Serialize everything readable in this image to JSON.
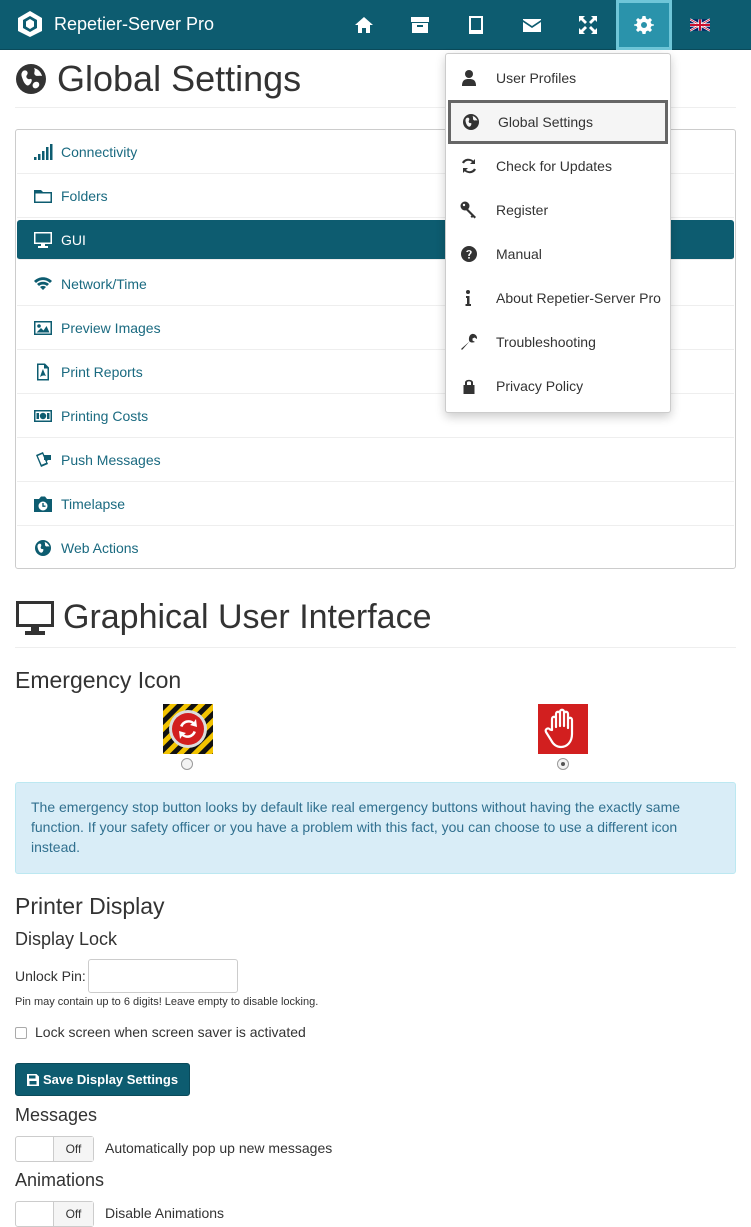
{
  "app": {
    "brand": "Repetier-Server Pro",
    "colors": {
      "primary": "#0d5c70",
      "active_nav": "#2a93ab"
    },
    "nav_icons": [
      "home-icon",
      "archive-icon",
      "tablet-icon",
      "envelope-icon",
      "fullscreen-icon",
      "gear-icon",
      "uk-flag-icon"
    ]
  },
  "page": {
    "title": "Global Settings"
  },
  "settings_menu": [
    {
      "label": "Connectivity",
      "icon": "signal-icon"
    },
    {
      "label": "Folders",
      "icon": "folder-icon"
    },
    {
      "label": "GUI",
      "icon": "monitor-icon",
      "active": true
    },
    {
      "label": "Network/Time",
      "icon": "wifi-icon"
    },
    {
      "label": "Preview Images",
      "icon": "image-icon"
    },
    {
      "label": "Print Reports",
      "icon": "pdf-icon"
    },
    {
      "label": "Printing Costs",
      "icon": "money-icon"
    },
    {
      "label": "Push Messages",
      "icon": "phone-message-icon"
    },
    {
      "label": "Timelapse",
      "icon": "camera-clock-icon"
    },
    {
      "label": "Web Actions",
      "icon": "globe-icon"
    }
  ],
  "dropdown": [
    {
      "label": "User Profiles",
      "icon": "user-icon"
    },
    {
      "label": "Global Settings",
      "icon": "globe-icon",
      "active": true
    },
    {
      "label": "Check for Updates",
      "icon": "refresh-icon"
    },
    {
      "label": "Register",
      "icon": "key-icon"
    },
    {
      "label": "Manual",
      "icon": "question-icon"
    },
    {
      "label": "About Repetier-Server Pro",
      "icon": "info-icon"
    },
    {
      "label": "Troubleshooting",
      "icon": "wrench-icon"
    },
    {
      "label": "Privacy Policy",
      "icon": "lock-icon"
    }
  ],
  "gui": {
    "title": "Graphical User Interface",
    "emergency": {
      "heading": "Emergency Icon",
      "selected": "hand",
      "info": "The emergency stop button looks by default like real emergency buttons without having the exactly same function. If your safety officer or you have a problem with this fact, you can choose to use a different icon instead."
    },
    "printer_display": {
      "heading": "Printer Display",
      "subheading": "Display Lock",
      "pin_label": "Unlock Pin:",
      "pin_value": "",
      "help": "Pin may contain up to 6 digits! Leave empty to disable locking.",
      "lock_checkbox_label": "Lock screen when screen saver is activated",
      "lock_checked": false,
      "save_label": "Save Display Settings"
    },
    "messages": {
      "heading": "Messages",
      "toggle": "Off",
      "label": "Automatically pop up new messages"
    },
    "animations": {
      "heading": "Animations",
      "toggle": "Off",
      "label": "Disable Animations"
    }
  }
}
